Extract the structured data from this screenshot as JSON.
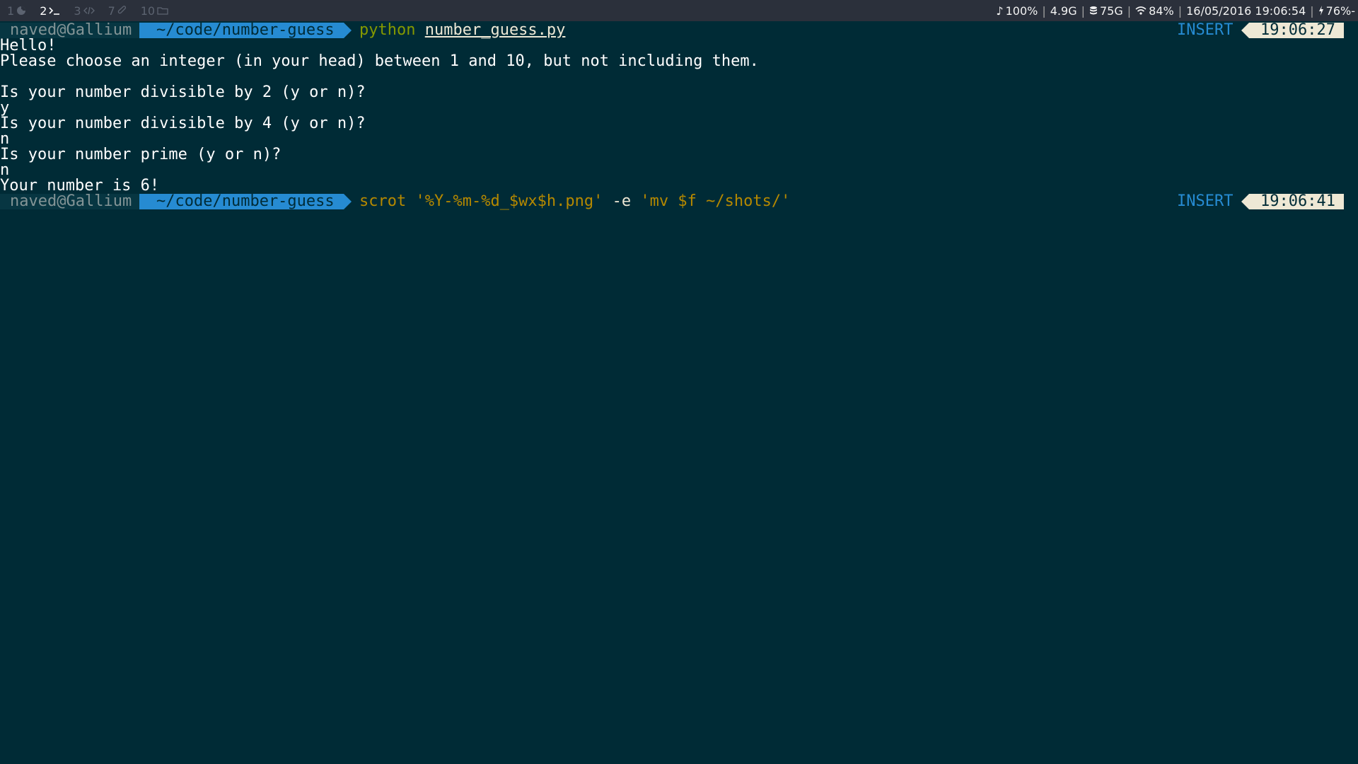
{
  "topbar": {
    "workspaces": [
      {
        "num": "1",
        "icon": "firefox-icon",
        "active": false
      },
      {
        "num": "2",
        "icon": "terminal-icon",
        "active": true
      },
      {
        "num": "3",
        "icon": "code-icon",
        "active": false
      },
      {
        "num": "7",
        "icon": "paperclip-icon",
        "active": false
      },
      {
        "num": "10",
        "icon": "folder-icon",
        "active": false
      }
    ],
    "status": {
      "volume": "100%",
      "memory": "4.9G",
      "disk": "75G",
      "wifi": "84%",
      "datetime": "16/05/2016 19:06:54",
      "battery": "76%-"
    }
  },
  "terminal": {
    "prompt1": {
      "user_host": "naved@Gallium",
      "path": "~/code/number-guess",
      "command": "python",
      "argument": "number_guess.py",
      "mode": "INSERT",
      "time": "19:06:27"
    },
    "output": [
      "Hello!",
      "Please choose an integer (in your head) between 1 and 10, but not including them.",
      "",
      "Is your number divisible by 2 (y or n)?",
      "y",
      "Is your number divisible by 4 (y or n)?",
      "n",
      "Is your number prime (y or n)?",
      "n",
      "Your number is 6!"
    ],
    "prompt2": {
      "user_host": "naved@Gallium",
      "path": "~/code/number-guess",
      "command": "scrot",
      "arg1": "'%Y-%m-%d_$wx$h.png'",
      "flag": "-e",
      "arg2": "'mv $f ~/shots/'",
      "mode": "INSERT",
      "time": "19:06:41"
    }
  },
  "colors": {
    "background": "#002b36",
    "topbar": "#2b303b",
    "path_segment": "#268bd2",
    "user_segment": "#073642",
    "time_segment": "#eee8d5",
    "command_green": "#859900",
    "string_yellow": "#b58900"
  }
}
